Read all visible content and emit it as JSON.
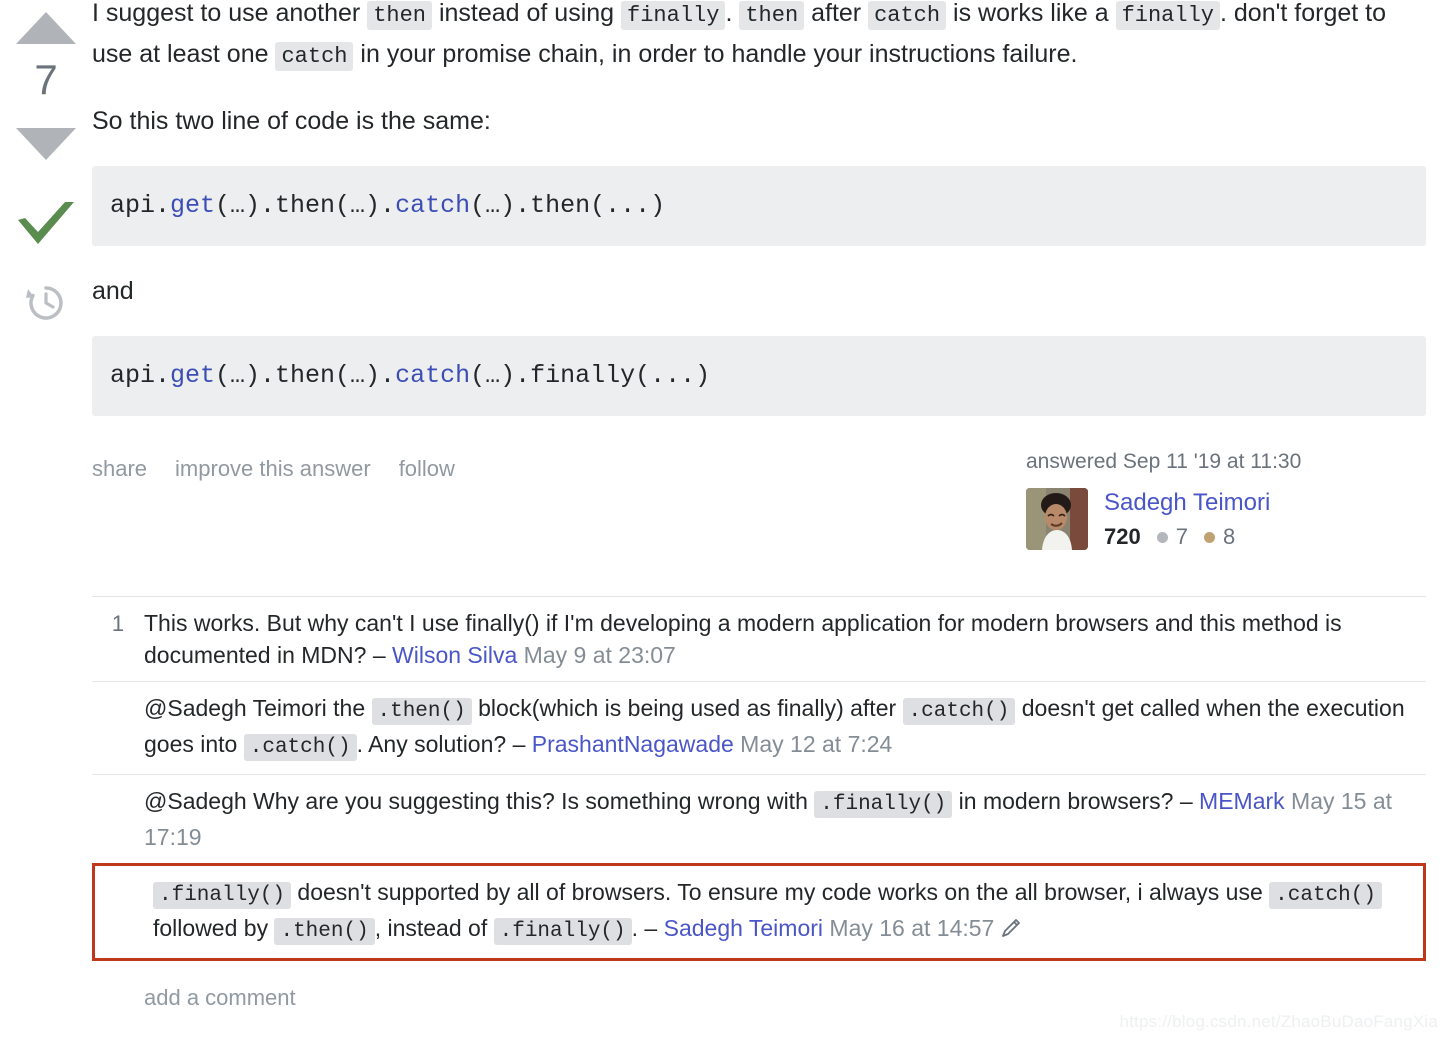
{
  "vote": {
    "up_icon": "triangle-up-icon",
    "down_icon": "triangle-down-icon",
    "score": "7",
    "accepted_icon": "checkmark-icon",
    "history_icon": "history-clock-icon"
  },
  "answer": {
    "paragraph1": {
      "seg1": "I suggest to use another ",
      "code1": "then",
      "seg2": " instead of using ",
      "code2": "finally",
      "seg3": ". ",
      "code3": "then",
      "seg4": " after ",
      "code4": "catch",
      "seg5": " is works like a ",
      "code5": "finally",
      "seg6": ". don't forget to use at least one ",
      "code6": "catch",
      "seg7": " in your promise chain, in order to handle your instructions failure."
    },
    "paragraph2": "So this two line of code is the same:",
    "code_block_1": {
      "pre": "api.",
      "fn1": "get",
      "mid1": "(…).then(…).",
      "fn2": "catch",
      "post": "(…).then(...)"
    },
    "paragraph3": "and",
    "code_block_2": {
      "pre": "api.",
      "fn1": "get",
      "mid1": "(…).then(…).",
      "fn2": "catch",
      "post": "(…).finally(...)"
    }
  },
  "post_menu": {
    "share": "share",
    "improve": "improve this answer",
    "follow": "follow"
  },
  "user_card": {
    "action_time": "answered Sep 11 '19 at 11:30",
    "display_name": "Sadegh Teimori",
    "reputation": "720",
    "silver_badges": "7",
    "bronze_badges": "8",
    "avatar_alt": "user-avatar"
  },
  "comments": [
    {
      "score": "1",
      "seg1": "This works. But why can't I use finally() if I'm developing a modern application for modern browsers and this method is documented in MDN? ",
      "dash": "– ",
      "user": "Wilson Silva",
      "date": " May 9 at 23:07",
      "highlighted": false
    },
    {
      "score": "",
      "seg1": "@Sadegh Teimori the ",
      "code1": ".then()",
      "seg2": " block(which is being used as finally) after ",
      "code2": ".catch()",
      "seg3": " doesn't get called when the execution goes into ",
      "code3": ".catch()",
      "seg4": ". Any solution? ",
      "dash": "– ",
      "user": "PrashantNagawade",
      "date": " May 12 at 7:24",
      "highlighted": false
    },
    {
      "score": "",
      "seg1": "@Sadegh Why are you suggesting this? Is something wrong with ",
      "code1": ".finally()",
      "seg2": " in modern browsers? ",
      "dash": "– ",
      "user": "MEMark",
      "date": " May 15 at 17:19",
      "highlighted": false
    },
    {
      "score": "",
      "code1": ".finally()",
      "seg1": " doesn't supported by all of browsers. To ensure my code works on the all browser, i always use ",
      "code2": ".catch()",
      "seg2": " followed by ",
      "code3": ".then()",
      "seg3": ", instead of ",
      "code4": ".finally()",
      "seg4": ". ",
      "dash": "– ",
      "user": "Sadegh Teimori",
      "date": " May 16 at 14:57",
      "edit_icon": "edit-pencil-icon",
      "highlighted": true
    }
  ],
  "add_comment_label": "add a comment",
  "watermark": "https://blog.csdn.net/ZhaoBuDaoFangXia",
  "colors": {
    "link": "#4a56c8",
    "accepted_green": "#5b8c4f",
    "highlight_border": "#c0381b",
    "code_bg": "#eceeef",
    "inline_code_bg": "#e4e6e8",
    "muted": "#6a737c",
    "silver_badge": "#b4b8bc",
    "bronze_badge": "#c0a172"
  }
}
